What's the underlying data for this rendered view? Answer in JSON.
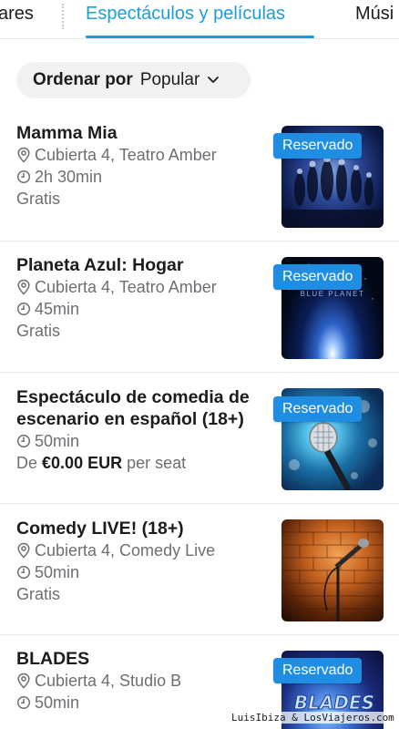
{
  "tabs": {
    "prev_label": "ares",
    "active_label": "Espectáculos y películas",
    "next_label": "Músi"
  },
  "sort": {
    "label": "Ordenar por",
    "value": "Popular"
  },
  "colors": {
    "accent": "#1a9ed8",
    "badge": "#1f8ee2",
    "text": "#1c1c1e",
    "muted": "#6e6e73"
  },
  "events": [
    {
      "title": "Mamma Mia",
      "location": "Cubierta 4, Teatro Amber",
      "duration": "2h 30min",
      "price": "Gratis",
      "badge": "Reservado"
    },
    {
      "title": "Planeta Azul: Hogar",
      "location": "Cubierta 4, Teatro Amber",
      "duration": "45min",
      "price": "Gratis",
      "badge": "Reservado",
      "image_text": "BLUE PLANET"
    },
    {
      "title_line1": "Espectáculo de comedia de",
      "title_line2": "escenario en español (18+)",
      "duration": "50min",
      "price_prefix": "De",
      "price_amount": "€0.00 EUR",
      "price_suffix": "per seat",
      "badge": "Reservado"
    },
    {
      "title": "Comedy LIVE! (18+)",
      "location": "Cubierta 4, Comedy Live",
      "duration": "50min",
      "price": "Gratis"
    },
    {
      "title": "BLADES",
      "location": "Cubierta 4, Studio B",
      "duration": "50min",
      "badge": "Reservado",
      "image_text": "BLADES"
    }
  ],
  "icons": {
    "location": "location-pin-icon",
    "duration": "clock-icon",
    "sort": "chevron-down-icon"
  },
  "watermark": "LuisIbiza & LosViajeros.com"
}
